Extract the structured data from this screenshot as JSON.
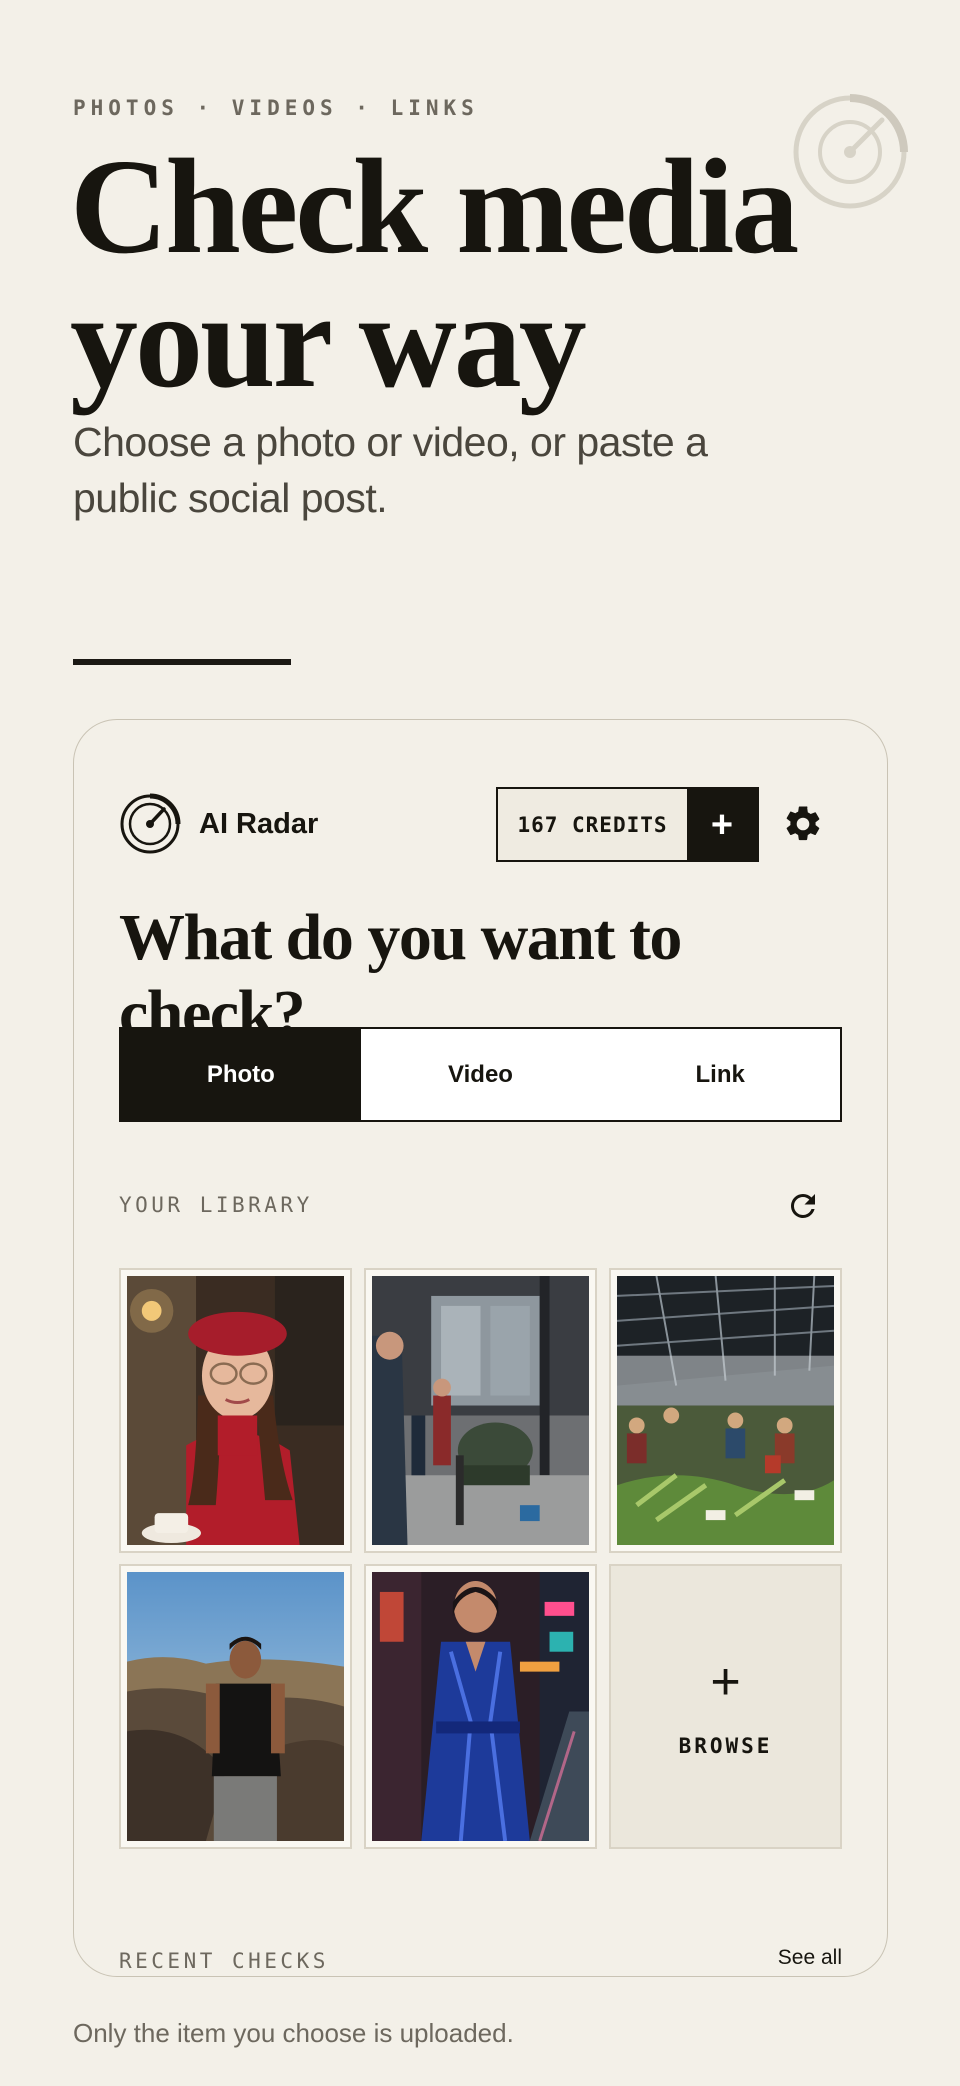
{
  "hero": {
    "eyebrow": "PHOTOS · VIDEOS · LINKS",
    "title_line1": "Check media",
    "title_line2": "your way",
    "subtitle": "Choose a photo or video, or paste a public social post."
  },
  "app": {
    "brand_name": "AI Radar",
    "brand_icon": "radar-gauge-icon",
    "credits_label": "167 CREDITS",
    "add_credits_label": "+",
    "settings_icon": "gear-icon",
    "question": "What do you want to check?",
    "tabs": [
      {
        "label": "Photo",
        "active": true
      },
      {
        "label": "Video",
        "active": false
      },
      {
        "label": "Link",
        "active": false
      }
    ],
    "library_label": "YOUR LIBRARY",
    "refresh_icon": "refresh-icon",
    "library": [
      {
        "name": "woman-red-beret-photo"
      },
      {
        "name": "street-scene-photo"
      },
      {
        "name": "market-hall-photo"
      },
      {
        "name": "man-black-tshirt-photo"
      },
      {
        "name": "blue-coat-neon-street-photo"
      }
    ],
    "browse_plus": "+",
    "browse_label": "BROWSE",
    "recent_label": "RECENT CHECKS",
    "see_all_label": "See all"
  },
  "footer": {
    "note": "Only the item you choose is uploaded."
  },
  "colors": {
    "background": "#f3f0e8",
    "ink": "#17150f",
    "muted": "#6d685e"
  }
}
